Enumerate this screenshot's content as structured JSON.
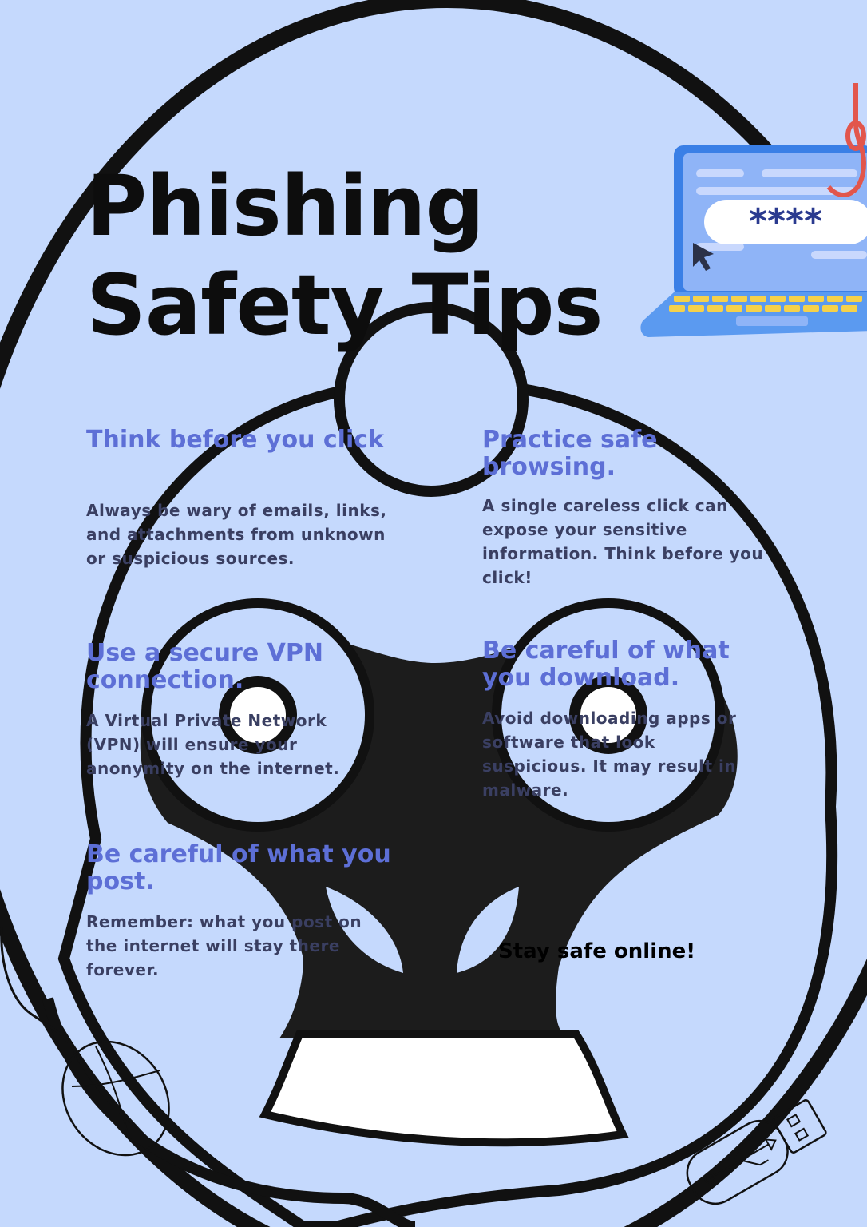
{
  "title": {
    "line1": "Phishing",
    "line2": "Safety Tips"
  },
  "tips": [
    {
      "heading": "Think before you click",
      "body": "Always be wary of emails, links, and attachments from unknown or suspicious sources."
    },
    {
      "heading": "Practice safe browsing.",
      "body": "A single careless click can expose your sensitive information. Think before you click!"
    },
    {
      "heading": "Use a secure VPN connection.",
      "body": "A Virtual Private Network (VPN) will ensure your anonymity on the internet."
    },
    {
      "heading": "Be careful of what you download.",
      "body": "Avoid downloading apps or software that look suspicious. It may result in malware."
    },
    {
      "heading": "Be careful of what you post.",
      "body": "Remember: what you post on the internet will stay there forever."
    }
  ],
  "footer": "Stay safe online!",
  "illustrations": {
    "laptop": {
      "password_mask": "****",
      "icon": "laptop-phishing-icon"
    },
    "mouse": {
      "icon": "computer-mouse-icon"
    },
    "usb": {
      "icon": "usb-drive-icon"
    }
  },
  "colors": {
    "background": "#c5d9fd",
    "heading": "#5d6fd6",
    "body_text": "#3a3f62",
    "title": "#0d0d0d",
    "face_ink": "#1c1c1c"
  }
}
